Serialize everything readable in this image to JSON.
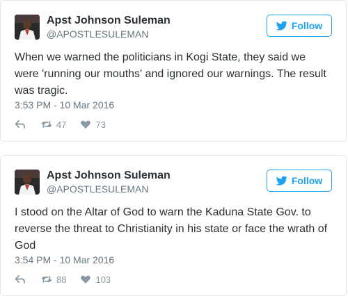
{
  "colors": {
    "accent": "#1da1f2",
    "secondary": "#66757f",
    "icon": "#8899a6",
    "border": "#e1e8ed"
  },
  "tweets": [
    {
      "author": "Apst Johnson Suleman",
      "handle": "@APOSTLESULEMAN",
      "follow_label": "Follow",
      "text": "When we warned the politicians in Kogi State, they said we were 'running our mouths' and ignored our warnings. The result was tragic.",
      "timestamp": "3:53 PM - 10 Mar 2016",
      "retweets": "47",
      "likes": "73",
      "icons": [
        "reply-icon",
        "retweet-icon",
        "heart-icon",
        "twitter-bird-icon"
      ]
    },
    {
      "author": "Apst Johnson Suleman",
      "handle": "@APOSTLESULEMAN",
      "follow_label": "Follow",
      "text": "I stood on the Altar of God to warn the Kaduna State Gov. to reverse the threat to Christianity in his state or face the wrath of God",
      "timestamp": "3:54 PM - 10 Mar 2016",
      "retweets": "88",
      "likes": "103",
      "icons": [
        "reply-icon",
        "retweet-icon",
        "heart-icon",
        "twitter-bird-icon"
      ]
    }
  ]
}
